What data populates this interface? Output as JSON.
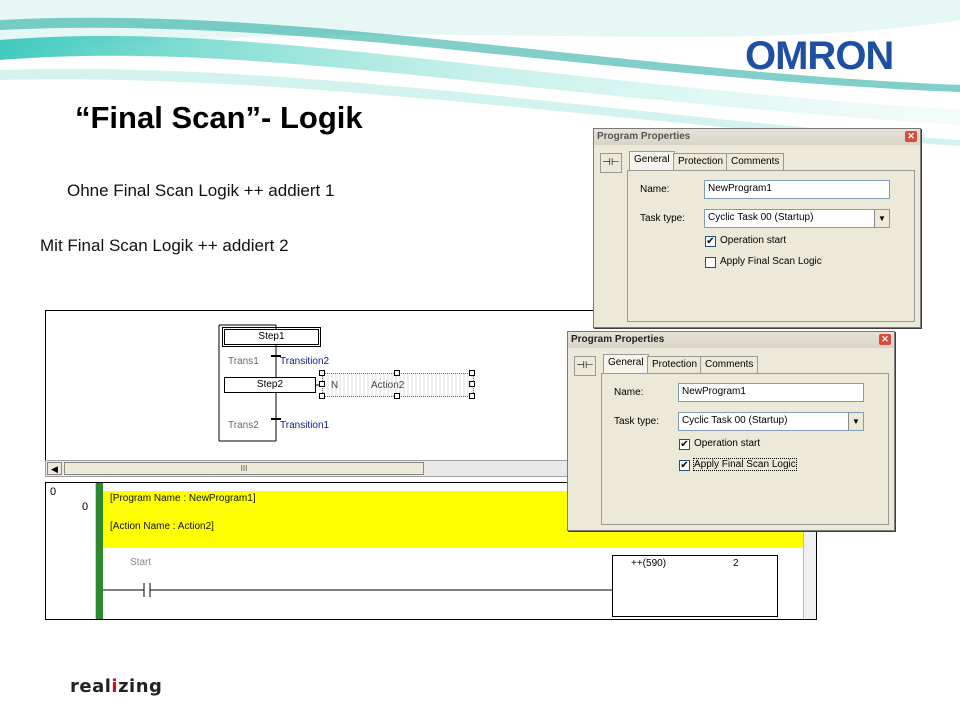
{
  "header": {
    "brand": "OMRON",
    "title": "“Final Scan”- Logik",
    "line1": "Ohne Final Scan Logik ++ addiert 1",
    "line2": "Mit Final Scan Logik ++ addiert 2",
    "footer_brand_pre": "real",
    "footer_brand_i": "i",
    "footer_brand_post": "zing"
  },
  "sfc": {
    "step1": "Step1",
    "trans1": "Trans1",
    "transition2": "Transition2",
    "step2": "Step2",
    "action_qualifier": "N",
    "action2": "Action2",
    "trans2": "Trans2",
    "transition1": "Transition1",
    "scroll_thumb": "III"
  },
  "ladder": {
    "row_top": "0",
    "rung": "0",
    "program_name": "[Program Name : NewProgram1]",
    "action_name": "[Action Name : Action2]",
    "start": "Start",
    "instruction": "++(590)",
    "operand": "2"
  },
  "dialog1": {
    "title": "Program Properties",
    "close": "✕",
    "pin": "⊣⊢",
    "tabs": [
      "General",
      "Protection",
      "Comments"
    ],
    "name_label": "Name:",
    "name_value": "NewProgram1",
    "task_label": "Task type:",
    "task_value": "Cyclic Task 00 (Startup)",
    "op_start_label": "Operation start",
    "op_start_checked": "✔",
    "final_scan_label": "Apply Final Scan Logic",
    "final_scan_checked": ""
  },
  "dialog2": {
    "title": "Program Properties",
    "close": "✕",
    "pin": "⊣⊢",
    "tabs": [
      "General",
      "Protection",
      "Comments"
    ],
    "name_label": "Name:",
    "name_value": "NewProgram1",
    "task_label": "Task type:",
    "task_value": "Cyclic Task 00 (Startup)",
    "op_start_label": "Operation start",
    "op_start_checked": "✔",
    "final_scan_label": "Apply Final Scan Logic",
    "final_scan_checked": "✔"
  },
  "colors": {
    "brand": "#1d4fa3",
    "highlight": "#ffff00",
    "rail": "#2c8a2c",
    "swoosh": "#2ec4b6"
  }
}
